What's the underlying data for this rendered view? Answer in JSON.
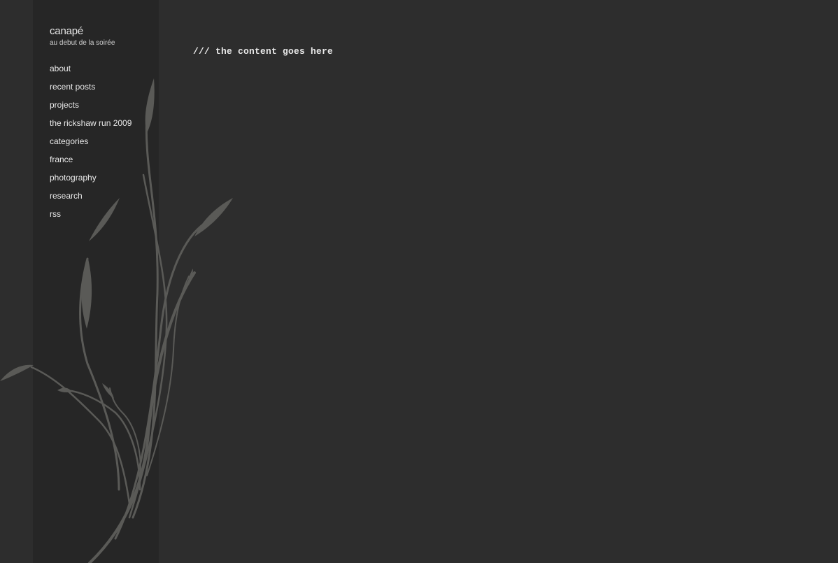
{
  "site": {
    "title": "canapé",
    "tagline": "au debut de la soirée"
  },
  "nav": {
    "items": [
      {
        "label": "about"
      },
      {
        "label": "recent posts"
      },
      {
        "label": "projects"
      },
      {
        "label": "the rickshaw run 2009"
      },
      {
        "label": "categories"
      },
      {
        "label": "france"
      },
      {
        "label": "photography"
      },
      {
        "label": "research"
      },
      {
        "label": "rss"
      }
    ]
  },
  "main": {
    "content_text": "/// the content goes here"
  },
  "colors": {
    "page_background": "#2d2d2d",
    "sidebar_background": "#262626",
    "plant_illustration": "#5a5a57",
    "text": "#e8e8e8"
  }
}
